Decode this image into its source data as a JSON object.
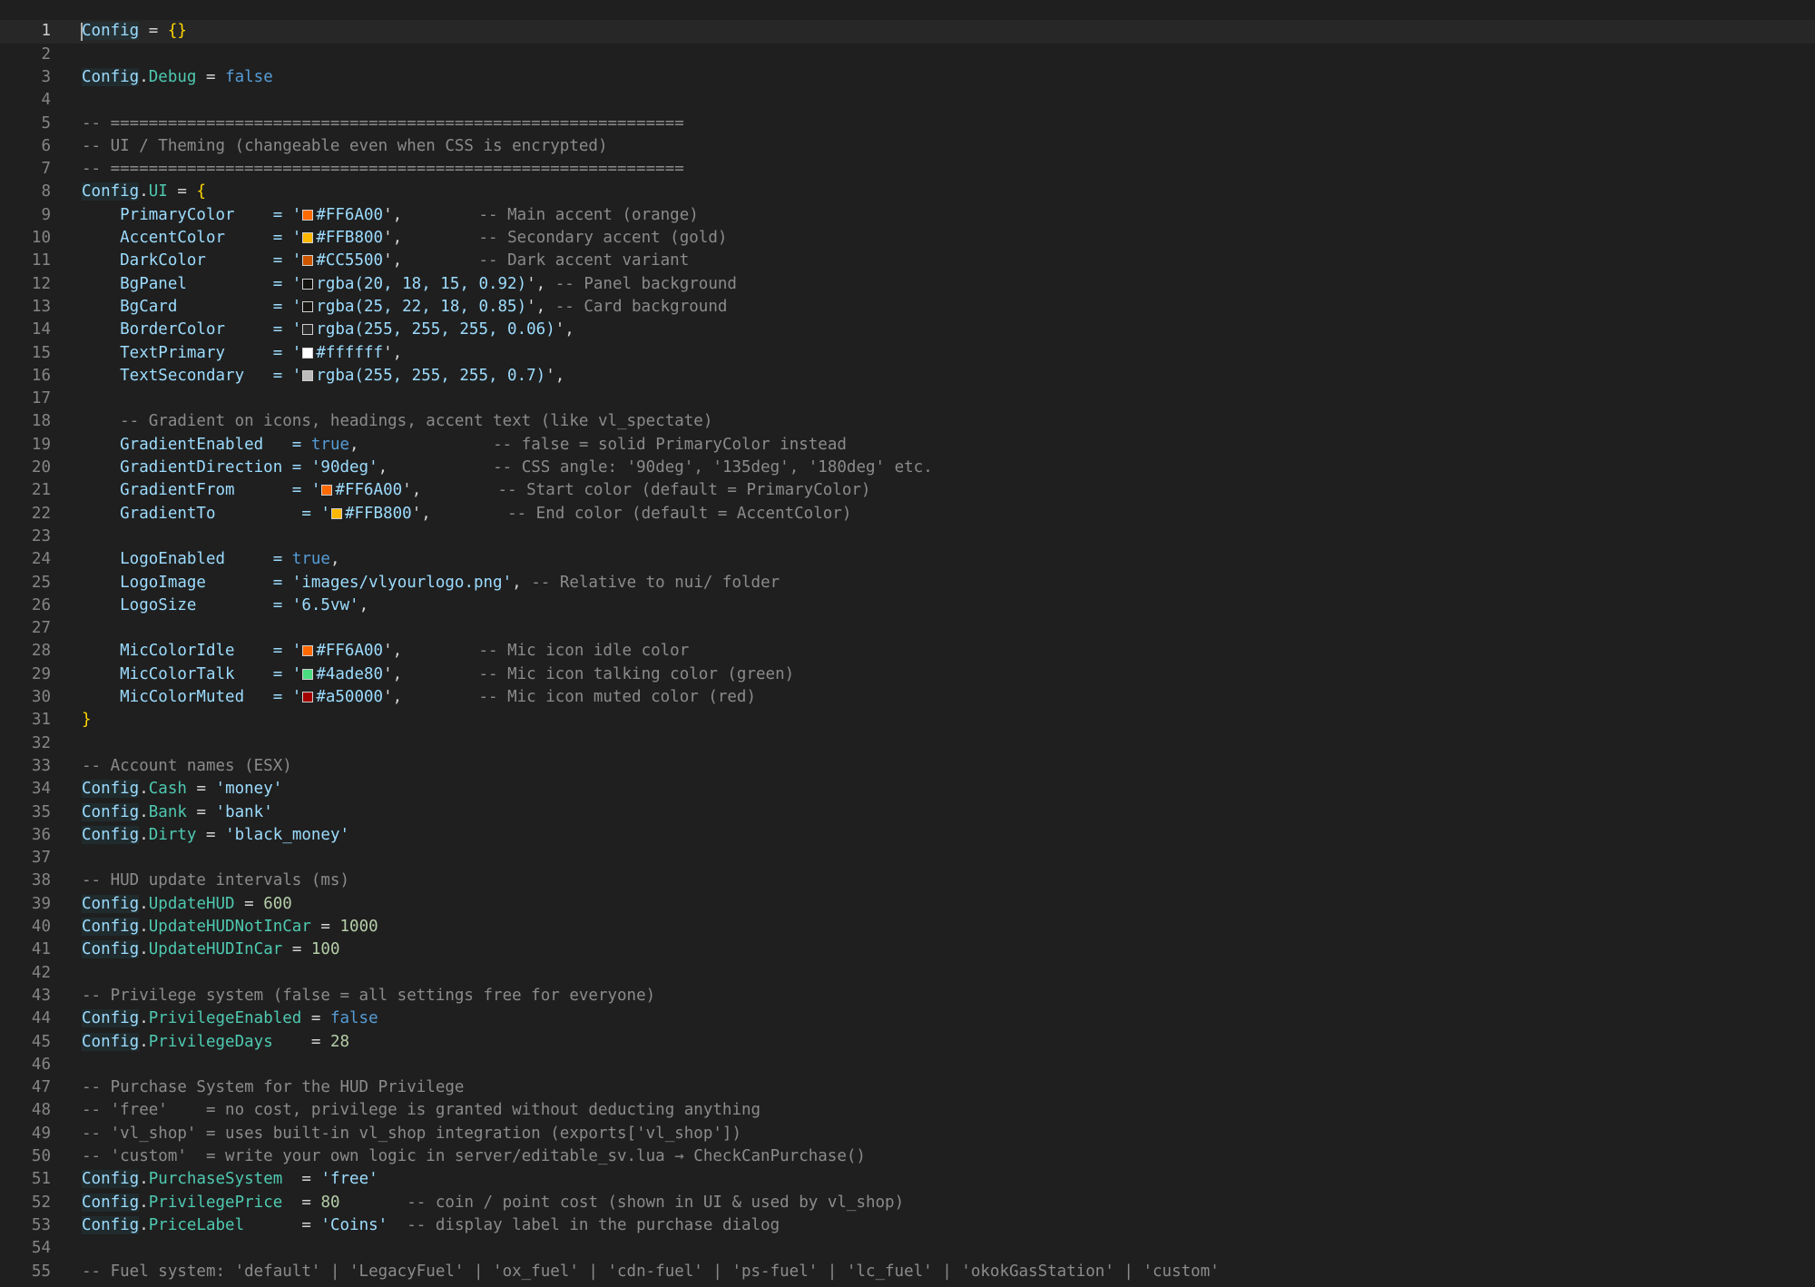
{
  "editor": {
    "lines": [
      {
        "n": "1",
        "tokens": [
          {
            "t": "Config",
            "c": "cfg"
          },
          {
            "t": " = ",
            "c": "op"
          },
          {
            "t": "{}",
            "c": "br1"
          }
        ]
      },
      {
        "n": "2",
        "tokens": []
      },
      {
        "n": "3",
        "tokens": [
          {
            "t": "Config",
            "c": "cfg"
          },
          {
            "t": ".",
            "c": "op"
          },
          {
            "t": "Debug",
            "c": "fld"
          },
          {
            "t": " = ",
            "c": "op"
          },
          {
            "t": "false",
            "c": "kw"
          }
        ]
      },
      {
        "n": "4",
        "tokens": []
      },
      {
        "n": "5",
        "tokens": [
          {
            "t": "-- ============================================================",
            "c": "cm"
          }
        ]
      },
      {
        "n": "6",
        "tokens": [
          {
            "t": "-- UI / Theming (changeable even when CSS is encrypted)",
            "c": "cm"
          }
        ]
      },
      {
        "n": "7",
        "tokens": [
          {
            "t": "-- ============================================================",
            "c": "cm"
          }
        ]
      },
      {
        "n": "8",
        "tokens": [
          {
            "t": "Config",
            "c": "cfg"
          },
          {
            "t": ".",
            "c": "op"
          },
          {
            "t": "UI",
            "c": "fld"
          },
          {
            "t": " = ",
            "c": "op"
          },
          {
            "t": "{",
            "c": "br1"
          }
        ]
      },
      {
        "n": "9",
        "tokens": [
          {
            "t": "    PrimaryColor    = '",
            "c": "id"
          },
          {
            "sw": "#FF6A00"
          },
          {
            "t": "#FF6A00",
            "c": "strv"
          },
          {
            "t": "',",
            "c": "p"
          },
          {
            "t": "        -- Main accent (orange)",
            "c": "cm"
          }
        ]
      },
      {
        "n": "10",
        "tokens": [
          {
            "t": "    AccentColor     = '",
            "c": "id"
          },
          {
            "sw": "#FFB800"
          },
          {
            "t": "#FFB800",
            "c": "strv"
          },
          {
            "t": "',",
            "c": "p"
          },
          {
            "t": "        -- Secondary accent (gold)",
            "c": "cm"
          }
        ]
      },
      {
        "n": "11",
        "tokens": [
          {
            "t": "    DarkColor       = '",
            "c": "id"
          },
          {
            "sw": "#CC5500"
          },
          {
            "t": "#CC5500",
            "c": "strv"
          },
          {
            "t": "',",
            "c": "p"
          },
          {
            "t": "        -- Dark accent variant",
            "c": "cm"
          }
        ]
      },
      {
        "n": "12",
        "tokens": [
          {
            "t": "    BgPanel         = '",
            "c": "id"
          },
          {
            "sw": "rgba(20,18,15,0.92)"
          },
          {
            "t": "rgba(20, 18, 15, 0.92)",
            "c": "strv"
          },
          {
            "t": "',",
            "c": "p"
          },
          {
            "t": " -- Panel background",
            "c": "cm"
          }
        ]
      },
      {
        "n": "13",
        "tokens": [
          {
            "t": "    BgCard          = '",
            "c": "id"
          },
          {
            "sw": "rgba(25,22,18,0.85)"
          },
          {
            "t": "rgba(25, 22, 18, 0.85)",
            "c": "strv"
          },
          {
            "t": "',",
            "c": "p"
          },
          {
            "t": " -- Card background",
            "c": "cm"
          }
        ]
      },
      {
        "n": "14",
        "tokens": [
          {
            "t": "    BorderColor     = '",
            "c": "id"
          },
          {
            "sw": "rgba(255,255,255,0.06)"
          },
          {
            "t": "rgba(255, 255, 255, 0.06)",
            "c": "strv"
          },
          {
            "t": "',",
            "c": "p"
          }
        ]
      },
      {
        "n": "15",
        "tokens": [
          {
            "t": "    TextPrimary     = '",
            "c": "id"
          },
          {
            "sw": "#ffffff"
          },
          {
            "t": "#ffffff",
            "c": "strv"
          },
          {
            "t": "',",
            "c": "p"
          }
        ]
      },
      {
        "n": "16",
        "tokens": [
          {
            "t": "    TextSecondary   = '",
            "c": "id"
          },
          {
            "sw": "rgba(255,255,255,0.7)"
          },
          {
            "t": "rgba(255, 255, 255, 0.7)",
            "c": "strv"
          },
          {
            "t": "',",
            "c": "p"
          }
        ]
      },
      {
        "n": "17",
        "tokens": []
      },
      {
        "n": "18",
        "tokens": [
          {
            "t": "    -- Gradient on icons, headings, accent text (like vl_spectate)",
            "c": "cm"
          }
        ]
      },
      {
        "n": "19",
        "tokens": [
          {
            "t": "    GradientEnabled   = ",
            "c": "id"
          },
          {
            "t": "true",
            "c": "kw"
          },
          {
            "t": ",",
            "c": "p"
          },
          {
            "t": "              -- false = solid PrimaryColor instead",
            "c": "cm"
          }
        ]
      },
      {
        "n": "20",
        "tokens": [
          {
            "t": "    GradientDirection = ",
            "c": "id"
          },
          {
            "t": "'90deg'",
            "c": "strv"
          },
          {
            "t": ",",
            "c": "p"
          },
          {
            "t": "           -- CSS angle: '90deg', '135deg', '180deg' etc.",
            "c": "cm"
          }
        ]
      },
      {
        "n": "21",
        "tokens": [
          {
            "t": "    GradientFrom      = '",
            "c": "id"
          },
          {
            "sw": "#FF6A00"
          },
          {
            "t": "#FF6A00",
            "c": "strv"
          },
          {
            "t": "',",
            "c": "p"
          },
          {
            "t": "        -- Start color (default = PrimaryColor)",
            "c": "cm"
          }
        ]
      },
      {
        "n": "22",
        "tokens": [
          {
            "t": "    GradientTo         = '",
            "c": "id"
          },
          {
            "sw": "#FFB800"
          },
          {
            "t": "#FFB800",
            "c": "strv"
          },
          {
            "t": "',",
            "c": "p"
          },
          {
            "t": "        -- End color (default = AccentColor)",
            "c": "cm"
          }
        ]
      },
      {
        "n": "23",
        "tokens": []
      },
      {
        "n": "24",
        "tokens": [
          {
            "t": "    LogoEnabled     = ",
            "c": "id"
          },
          {
            "t": "true",
            "c": "kw"
          },
          {
            "t": ",",
            "c": "p"
          }
        ]
      },
      {
        "n": "25",
        "tokens": [
          {
            "t": "    LogoImage       = ",
            "c": "id"
          },
          {
            "t": "'images/vlyourlogo.png'",
            "c": "strv"
          },
          {
            "t": ",",
            "c": "p"
          },
          {
            "t": " -- Relative to nui/ folder",
            "c": "cm"
          }
        ]
      },
      {
        "n": "26",
        "tokens": [
          {
            "t": "    LogoSize        = ",
            "c": "id"
          },
          {
            "t": "'6.5vw'",
            "c": "strv"
          },
          {
            "t": ",",
            "c": "p"
          }
        ]
      },
      {
        "n": "27",
        "tokens": []
      },
      {
        "n": "28",
        "tokens": [
          {
            "t": "    MicColorIdle    = '",
            "c": "id"
          },
          {
            "sw": "#FF6A00"
          },
          {
            "t": "#FF6A00",
            "c": "strv"
          },
          {
            "t": "',",
            "c": "p"
          },
          {
            "t": "        -- Mic icon idle color",
            "c": "cm"
          }
        ]
      },
      {
        "n": "29",
        "tokens": [
          {
            "t": "    MicColorTalk    = '",
            "c": "id"
          },
          {
            "sw": "#4ade80"
          },
          {
            "t": "#4ade80",
            "c": "strv"
          },
          {
            "t": "',",
            "c": "p"
          },
          {
            "t": "        -- Mic icon talking color (green)",
            "c": "cm"
          }
        ]
      },
      {
        "n": "30",
        "tokens": [
          {
            "t": "    MicColorMuted   = '",
            "c": "id"
          },
          {
            "sw": "#a50000"
          },
          {
            "t": "#a50000",
            "c": "strv"
          },
          {
            "t": "',",
            "c": "p"
          },
          {
            "t": "        -- Mic icon muted color (red)",
            "c": "cm"
          }
        ]
      },
      {
        "n": "31",
        "tokens": [
          {
            "t": "}",
            "c": "br1"
          }
        ]
      },
      {
        "n": "32",
        "tokens": []
      },
      {
        "n": "33",
        "tokens": [
          {
            "t": "-- Account names (ESX)",
            "c": "cm"
          }
        ]
      },
      {
        "n": "34",
        "tokens": [
          {
            "t": "Config",
            "c": "cfg"
          },
          {
            "t": ".",
            "c": "op"
          },
          {
            "t": "Cash",
            "c": "fld"
          },
          {
            "t": " = ",
            "c": "op"
          },
          {
            "t": "'money'",
            "c": "strv"
          }
        ]
      },
      {
        "n": "35",
        "tokens": [
          {
            "t": "Config",
            "c": "cfg"
          },
          {
            "t": ".",
            "c": "op"
          },
          {
            "t": "Bank",
            "c": "fld"
          },
          {
            "t": " = ",
            "c": "op"
          },
          {
            "t": "'bank'",
            "c": "strv"
          }
        ]
      },
      {
        "n": "36",
        "tokens": [
          {
            "t": "Config",
            "c": "cfg"
          },
          {
            "t": ".",
            "c": "op"
          },
          {
            "t": "Dirty",
            "c": "fld"
          },
          {
            "t": " = ",
            "c": "op"
          },
          {
            "t": "'black_money'",
            "c": "strv"
          }
        ]
      },
      {
        "n": "37",
        "tokens": []
      },
      {
        "n": "38",
        "tokens": [
          {
            "t": "-- HUD update intervals (ms)",
            "c": "cm"
          }
        ]
      },
      {
        "n": "39",
        "tokens": [
          {
            "t": "Config",
            "c": "cfg"
          },
          {
            "t": ".",
            "c": "op"
          },
          {
            "t": "UpdateHUD",
            "c": "fld"
          },
          {
            "t": " = ",
            "c": "op"
          },
          {
            "t": "600",
            "c": "num"
          }
        ]
      },
      {
        "n": "40",
        "tokens": [
          {
            "t": "Config",
            "c": "cfg"
          },
          {
            "t": ".",
            "c": "op"
          },
          {
            "t": "UpdateHUDNotInCar",
            "c": "fld"
          },
          {
            "t": " = ",
            "c": "op"
          },
          {
            "t": "1000",
            "c": "num"
          }
        ]
      },
      {
        "n": "41",
        "tokens": [
          {
            "t": "Config",
            "c": "cfg"
          },
          {
            "t": ".",
            "c": "op"
          },
          {
            "t": "UpdateHUDInCar",
            "c": "fld"
          },
          {
            "t": " = ",
            "c": "op"
          },
          {
            "t": "100",
            "c": "num"
          }
        ]
      },
      {
        "n": "42",
        "tokens": []
      },
      {
        "n": "43",
        "tokens": [
          {
            "t": "-- Privilege system (false = all settings free for everyone)",
            "c": "cm"
          }
        ]
      },
      {
        "n": "44",
        "tokens": [
          {
            "t": "Config",
            "c": "cfg"
          },
          {
            "t": ".",
            "c": "op"
          },
          {
            "t": "PrivilegeEnabled",
            "c": "fld"
          },
          {
            "t": " = ",
            "c": "op"
          },
          {
            "t": "false",
            "c": "kw"
          }
        ]
      },
      {
        "n": "45",
        "tokens": [
          {
            "t": "Config",
            "c": "cfg"
          },
          {
            "t": ".",
            "c": "op"
          },
          {
            "t": "PrivilegeDays",
            "c": "fld"
          },
          {
            "t": "    = ",
            "c": "op"
          },
          {
            "t": "28",
            "c": "num"
          }
        ]
      },
      {
        "n": "46",
        "tokens": []
      },
      {
        "n": "47",
        "tokens": [
          {
            "t": "-- Purchase System for the HUD Privilege",
            "c": "cm"
          }
        ]
      },
      {
        "n": "48",
        "tokens": [
          {
            "t": "-- 'free'    = no cost, privilege is granted without deducting anything",
            "c": "cm"
          }
        ]
      },
      {
        "n": "49",
        "tokens": [
          {
            "t": "-- 'vl_shop' = uses built-in vl_shop integration (exports['vl_shop'])",
            "c": "cm"
          }
        ]
      },
      {
        "n": "50",
        "tokens": [
          {
            "t": "-- 'custom'  = write your own logic in server/editable_sv.lua → CheckCanPurchase()",
            "c": "cm"
          }
        ]
      },
      {
        "n": "51",
        "tokens": [
          {
            "t": "Config",
            "c": "cfg"
          },
          {
            "t": ".",
            "c": "op"
          },
          {
            "t": "PurchaseSystem",
            "c": "fld"
          },
          {
            "t": "  = ",
            "c": "op"
          },
          {
            "t": "'free'",
            "c": "strv"
          }
        ]
      },
      {
        "n": "52",
        "tokens": [
          {
            "t": "Config",
            "c": "cfg"
          },
          {
            "t": ".",
            "c": "op"
          },
          {
            "t": "PrivilegePrice",
            "c": "fld"
          },
          {
            "t": "  = ",
            "c": "op"
          },
          {
            "t": "80",
            "c": "num"
          },
          {
            "t": "       -- coin / point cost (shown in UI & used by vl_shop)",
            "c": "cm"
          }
        ]
      },
      {
        "n": "53",
        "tokens": [
          {
            "t": "Config",
            "c": "cfg"
          },
          {
            "t": ".",
            "c": "op"
          },
          {
            "t": "PriceLabel",
            "c": "fld"
          },
          {
            "t": "      = ",
            "c": "op"
          },
          {
            "t": "'Coins'",
            "c": "strv"
          },
          {
            "t": "  -- display label in the purchase dialog",
            "c": "cm"
          }
        ]
      },
      {
        "n": "54",
        "tokens": []
      },
      {
        "n": "55",
        "tokens": [
          {
            "t": "-- Fuel system: 'default' | 'LegacyFuel' | 'ox_fuel' | 'cdn-fuel' | 'ps-fuel' | 'lc_fuel' | 'okokGasStation' | 'custom'",
            "c": "cm"
          }
        ]
      }
    ]
  }
}
